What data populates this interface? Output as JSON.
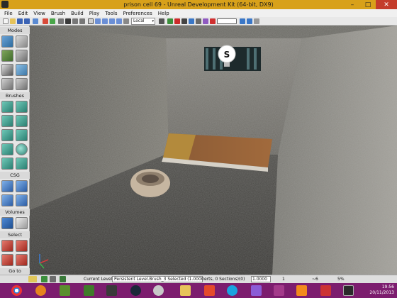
{
  "window": {
    "title": "prison cell 69 - Unreal Development Kit (64-bit, DX9)",
    "controls": {
      "minimize": "–",
      "maximize": "□",
      "close": "✕"
    }
  },
  "menu": [
    "File",
    "Edit",
    "View",
    "Brush",
    "Build",
    "Play",
    "Tools",
    "Preferences",
    "Help"
  ],
  "toolbar": {
    "coord_system": "Local",
    "coord_arrow": "▾"
  },
  "modes_panel": {
    "sections": [
      "Modes",
      "Brushes",
      "CSG",
      "Volumes",
      "Select",
      "Go to"
    ]
  },
  "viewport": {
    "light_actor_label": "S"
  },
  "statusbar": {
    "current_level_label": "Current Level:",
    "current_level_value": "Persistent Level.Brush_3 Selected (1.0000",
    "selection_info": "erts, 0 Sections)(0)",
    "value1": "1.0000",
    "grid": "1",
    "angle": "~6",
    "zoom": "5%"
  },
  "taskbar": {
    "time": "19:56",
    "date": "20/11/2013",
    "apps": [
      "chrome-icon",
      "windows-media-player-icon",
      "minecraft-icon",
      "minecraft-icon-2",
      "game-icon",
      "steam-icon",
      "disk-icon",
      "folder-icon",
      "paint-icon",
      "skype-icon",
      "pencil-icon",
      "winrar-icon",
      "vlc-icon",
      "gamemaker-icon",
      "udk-icon"
    ]
  },
  "colors": {
    "titlebar": "#d8a11a",
    "taskbar": "#7c1d6e",
    "close": "#c43c2b"
  }
}
